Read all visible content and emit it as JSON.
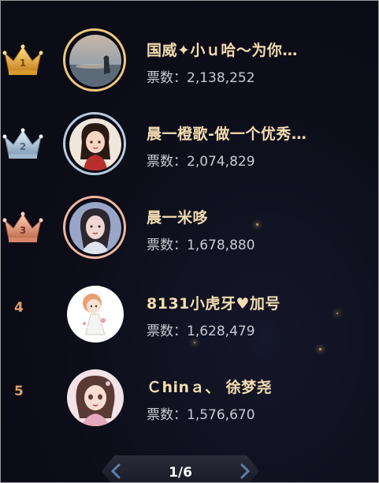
{
  "rankings": [
    {
      "rank": "1",
      "name": "国威✦小ｕ哈～为你…",
      "votes_label": "票数：",
      "votes": "2,138,252",
      "crown": "gold",
      "avatar": "sunset-seaside-photo"
    },
    {
      "rank": "2",
      "name": "晨一橙歌-做一个优秀…",
      "votes_label": "票数：",
      "votes": "2,074,829",
      "crown": "silver",
      "avatar": "cartoon-girl-red-dress"
    },
    {
      "rank": "3",
      "name": "晨一米哆",
      "votes_label": "票数：",
      "votes": "1,678,880",
      "crown": "bronze",
      "avatar": "girl-portrait-blue"
    },
    {
      "rank": "4",
      "name": "8131小虎牙♥加号",
      "votes_label": "票数：",
      "votes": "1,628,479",
      "crown": "",
      "avatar": "chibi-girl-white"
    },
    {
      "rank": "5",
      "name": "Ｃhinａ、 徐梦尧",
      "votes_label": "票数：",
      "votes": "1,576,670",
      "crown": "",
      "avatar": "anime-girl-pink"
    }
  ],
  "pagination": {
    "text": "1/6",
    "prev_icon": "chevron-left-icon",
    "next_icon": "chevron-right-icon"
  },
  "colors": {
    "name": "#f4ddb0",
    "votes": "#c9cbd3",
    "gold": "#f0b94a",
    "silver": "#a9c4dc",
    "bronze": "#e39a7e",
    "rank_num": "#d9a070"
  }
}
